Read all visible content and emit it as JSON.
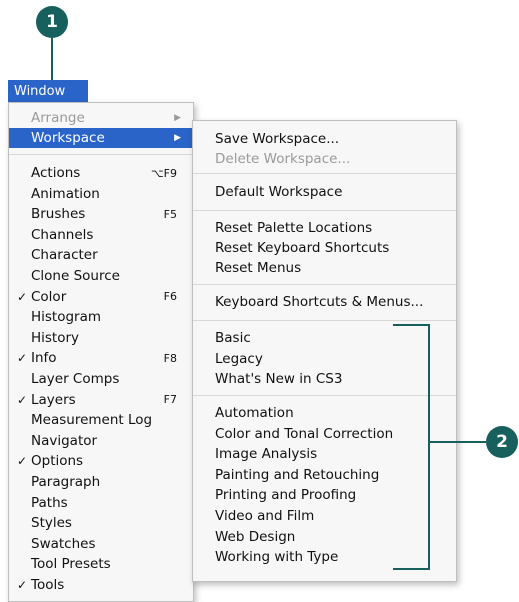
{
  "callouts": {
    "one": "1",
    "two": "2"
  },
  "menubar": {
    "title": "Window"
  },
  "window_menu": {
    "arrange": "Arrange",
    "workspace": "Workspace",
    "items": [
      {
        "check": "",
        "label": "Actions",
        "shortcut": "⌥F9"
      },
      {
        "check": "",
        "label": "Animation",
        "shortcut": ""
      },
      {
        "check": "",
        "label": "Brushes",
        "shortcut": "F5"
      },
      {
        "check": "",
        "label": "Channels",
        "shortcut": ""
      },
      {
        "check": "",
        "label": "Character",
        "shortcut": ""
      },
      {
        "check": "",
        "label": "Clone Source",
        "shortcut": ""
      },
      {
        "check": "✓",
        "label": "Color",
        "shortcut": "F6"
      },
      {
        "check": "",
        "label": "Histogram",
        "shortcut": ""
      },
      {
        "check": "",
        "label": "History",
        "shortcut": ""
      },
      {
        "check": "✓",
        "label": "Info",
        "shortcut": "F8"
      },
      {
        "check": "",
        "label": "Layer Comps",
        "shortcut": ""
      },
      {
        "check": "✓",
        "label": "Layers",
        "shortcut": "F7"
      },
      {
        "check": "",
        "label": "Measurement Log",
        "shortcut": ""
      },
      {
        "check": "",
        "label": "Navigator",
        "shortcut": ""
      },
      {
        "check": "✓",
        "label": "Options",
        "shortcut": ""
      },
      {
        "check": "",
        "label": "Paragraph",
        "shortcut": ""
      },
      {
        "check": "",
        "label": "Paths",
        "shortcut": ""
      },
      {
        "check": "",
        "label": "Styles",
        "shortcut": ""
      },
      {
        "check": "",
        "label": "Swatches",
        "shortcut": ""
      },
      {
        "check": "",
        "label": "Tool Presets",
        "shortcut": ""
      },
      {
        "check": "✓",
        "label": "Tools",
        "shortcut": ""
      }
    ]
  },
  "workspace_menu": {
    "save": "Save Workspace...",
    "delete": "Delete Workspace...",
    "default": "Default Workspace",
    "reset_palette": "Reset Palette Locations",
    "reset_keyboard": "Reset Keyboard Shortcuts",
    "reset_menus": "Reset Menus",
    "keyboard_menus": "Keyboard Shortcuts & Menus...",
    "group_a": [
      "Basic",
      "Legacy",
      "What's New in CS3"
    ],
    "group_b": [
      "Automation",
      "Color and Tonal Correction",
      "Image Analysis",
      "Painting and Retouching",
      "Printing and Proofing",
      "Video and Film",
      "Web Design",
      "Working with Type"
    ]
  }
}
